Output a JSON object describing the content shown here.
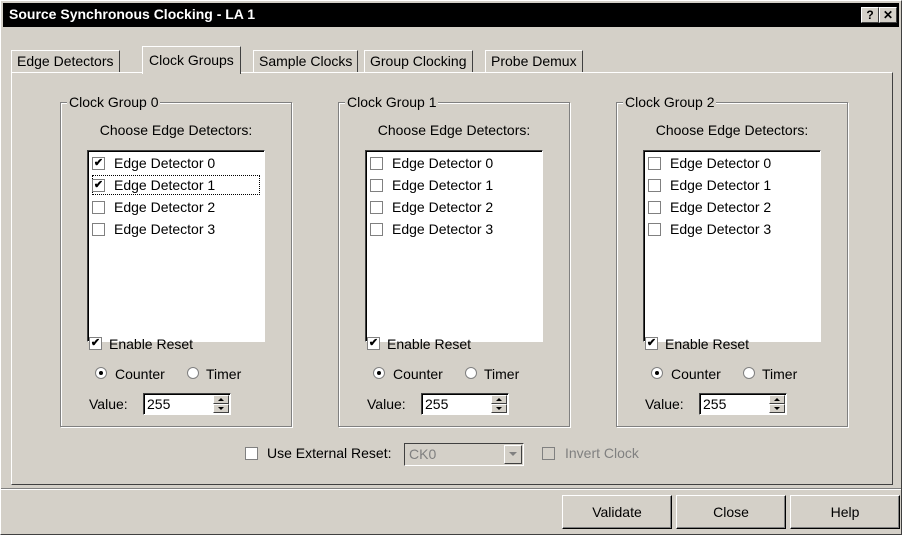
{
  "window": {
    "title": "Source Synchronous Clocking - LA 1",
    "help_glyph": "?",
    "close_glyph": "✕"
  },
  "tabs": [
    {
      "label": "Edge Detectors",
      "active": false
    },
    {
      "label": "Clock Groups",
      "active": true
    },
    {
      "label": "Sample Clocks",
      "active": false
    },
    {
      "label": "Group Clocking",
      "active": false
    },
    {
      "label": "Probe Demux",
      "active": false
    }
  ],
  "groups": [
    {
      "title": "Clock Group 0",
      "choose_label": "Choose Edge Detectors:",
      "detectors": [
        {
          "label": "Edge Detector 0",
          "checked": true
        },
        {
          "label": "Edge Detector 1",
          "checked": true
        },
        {
          "label": "Edge Detector 2",
          "checked": false
        },
        {
          "label": "Edge Detector 3",
          "checked": false
        }
      ],
      "enable_reset_label": "Enable Reset",
      "enable_reset_checked": true,
      "counter_label": "Counter",
      "timer_label": "Timer",
      "mode": "Counter",
      "value_label": "Value:",
      "value": "255"
    },
    {
      "title": "Clock Group 1",
      "choose_label": "Choose Edge Detectors:",
      "detectors": [
        {
          "label": "Edge Detector 0",
          "checked": false
        },
        {
          "label": "Edge Detector 1",
          "checked": false
        },
        {
          "label": "Edge Detector 2",
          "checked": false
        },
        {
          "label": "Edge Detector 3",
          "checked": false
        }
      ],
      "enable_reset_label": "Enable Reset",
      "enable_reset_checked": true,
      "counter_label": "Counter",
      "timer_label": "Timer",
      "mode": "Counter",
      "value_label": "Value:",
      "value": "255"
    },
    {
      "title": "Clock Group 2",
      "choose_label": "Choose Edge Detectors:",
      "detectors": [
        {
          "label": "Edge Detector 0",
          "checked": false
        },
        {
          "label": "Edge Detector 1",
          "checked": false
        },
        {
          "label": "Edge Detector 2",
          "checked": false
        },
        {
          "label": "Edge Detector 3",
          "checked": false
        }
      ],
      "enable_reset_label": "Enable Reset",
      "enable_reset_checked": true,
      "counter_label": "Counter",
      "timer_label": "Timer",
      "mode": "Counter",
      "value_label": "Value:",
      "value": "255"
    }
  ],
  "external_reset": {
    "label": "Use External Reset:",
    "checked": false,
    "selected": "CK0",
    "invert_label": "Invert Clock",
    "invert_checked": false
  },
  "buttons": {
    "validate": "Validate",
    "close": "Close",
    "help": "Help"
  }
}
